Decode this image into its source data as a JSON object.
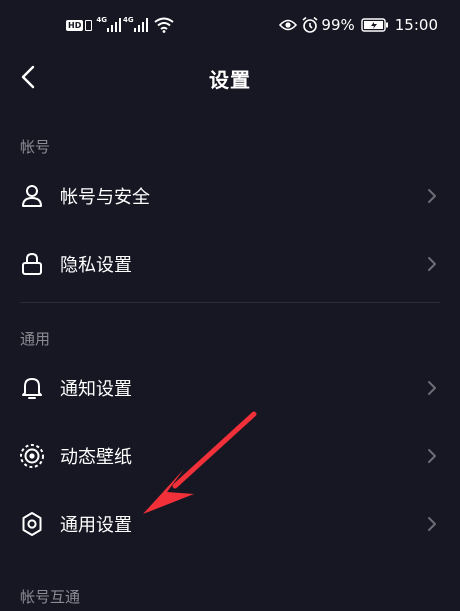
{
  "status_bar": {
    "hd": "HD",
    "net1": "4G",
    "net2": "4G",
    "battery_pct": "99%",
    "time": "15:00",
    "icons": [
      "eye-icon",
      "alarm-icon",
      "battery-icon",
      "wifi-icon",
      "signal-icon"
    ]
  },
  "header": {
    "title": "设置",
    "back_icon": "chevron-left-icon"
  },
  "sections": [
    {
      "label": "帐号",
      "items": [
        {
          "label": "帐号与安全",
          "icon": "user-icon"
        },
        {
          "label": "隐私设置",
          "icon": "lock-icon"
        }
      ]
    },
    {
      "label": "通用",
      "items": [
        {
          "label": "通知设置",
          "icon": "bell-icon"
        },
        {
          "label": "动态壁纸",
          "icon": "live-wallpaper-icon"
        },
        {
          "label": "通用设置",
          "icon": "gear-icon"
        }
      ]
    },
    {
      "label": "帐号互通",
      "items": []
    }
  ],
  "colors": {
    "background": "#161722",
    "text": "#ffffff",
    "section_label": "#8a8b93",
    "chevron": "#6b6c74",
    "annotation_arrow": "#f2303a"
  }
}
